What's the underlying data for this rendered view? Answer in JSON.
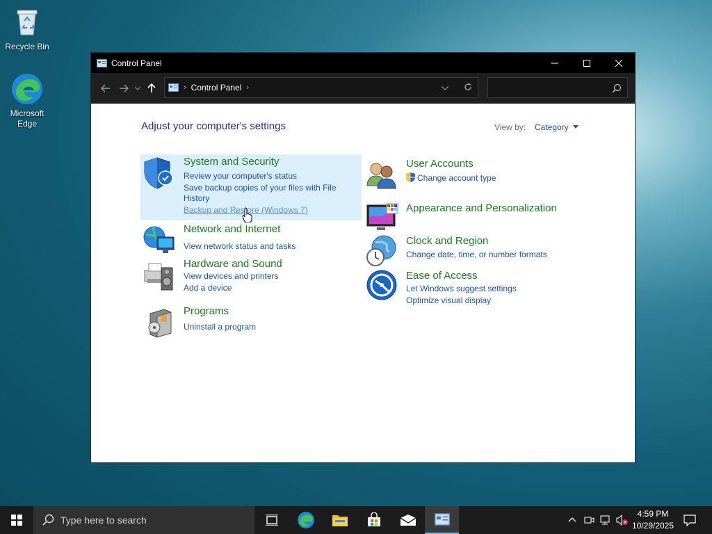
{
  "desktop": {
    "icons": [
      {
        "label": "Recycle Bin"
      },
      {
        "label": "Microsoft Edge"
      }
    ]
  },
  "window": {
    "title": "Control Panel",
    "address": {
      "root_label": "Control Panel"
    },
    "search": {
      "placeholder": ""
    },
    "heading": "Adjust your computer's settings",
    "view_by_label": "View by:",
    "view_by_value": "Category",
    "categories": [
      {
        "title": "System and Security",
        "icon": "shield-icon",
        "links": [
          "Review your computer's status",
          "Save backup copies of your files with File",
          "History",
          "Backup and Restore (Windows 7)"
        ]
      },
      {
        "title": "Network and Internet",
        "icon": "network-globe-icon",
        "links": [
          "View network status and tasks"
        ]
      },
      {
        "title": "Hardware and Sound",
        "icon": "printer-speaker-icon",
        "links": [
          "View devices and printers",
          "Add a device"
        ]
      },
      {
        "title": "Programs",
        "icon": "programs-box-icon",
        "links": [
          "Uninstall a program"
        ]
      },
      {
        "title": "User Accounts",
        "icon": "users-icon",
        "links": [
          "Change account type"
        ]
      },
      {
        "title": "Appearance and Personalization",
        "icon": "monitor-palette-icon",
        "links": []
      },
      {
        "title": "Clock and Region",
        "icon": "clock-globe-icon",
        "links": [
          "Change date, time, or number formats"
        ]
      },
      {
        "title": "Ease of Access",
        "icon": "ease-of-access-icon",
        "links": [
          "Let Windows suggest settings",
          "Optimize visual display"
        ]
      }
    ]
  },
  "taskbar": {
    "search_placeholder": "Type here to search",
    "pinned": [
      "task-view-icon",
      "edge-icon",
      "file-explorer-icon",
      "store-icon",
      "mail-icon",
      "control-panel-icon"
    ],
    "clock_time": "4:59 PM",
    "clock_date": "10/29/2025"
  },
  "colors": {
    "link": "#1b55a9",
    "category_title": "#1c7a1c",
    "heading": "#1e3287",
    "highlight": "#dbeefb",
    "titlebar": "#000000"
  }
}
